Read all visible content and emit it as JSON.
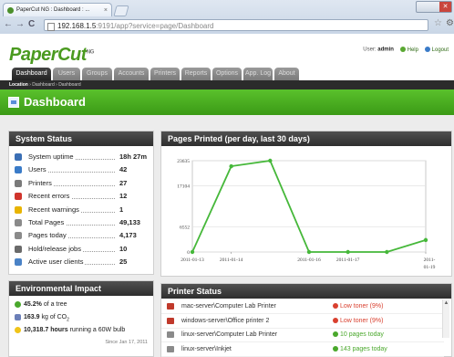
{
  "browser": {
    "tab_title": "PaperCut NG : Dashboard : ...",
    "tab_close": "×",
    "nav_back": "←",
    "nav_forward": "→",
    "nav_reload": "C",
    "url_host": "192.168.1.5",
    "url_rest": ":9191/app?service=page/Dashboard",
    "star": "☆",
    "menu": "🔧"
  },
  "header": {
    "logo": "PaperCut",
    "logo_mark": "NG",
    "user_label": "User:",
    "user_name": "admin",
    "help": "Help",
    "logout": "Logout"
  },
  "tabs": [
    {
      "label": "Dashboard",
      "active": true
    },
    {
      "label": "Users"
    },
    {
      "label": "Groups"
    },
    {
      "label": "Accounts"
    },
    {
      "label": "Printers"
    },
    {
      "label": "Reports"
    },
    {
      "label": "Options"
    },
    {
      "label": "App. Log"
    },
    {
      "label": "About"
    }
  ],
  "location": {
    "prefix": "Location",
    "path": "› Dashboard › Dashboard"
  },
  "page_title": "Dashboard",
  "system_status": {
    "title": "System Status",
    "rows": [
      {
        "label": "System uptime",
        "value": "18h 27m",
        "color": "#3b6fb5"
      },
      {
        "label": "Users",
        "value": "42",
        "color": "#3a7bc8"
      },
      {
        "label": "Printers",
        "value": "27",
        "color": "#7a7a7a"
      },
      {
        "label": "Recent errors",
        "value": "12",
        "color": "#d0342c"
      },
      {
        "label": "Recent warnings",
        "value": "1",
        "color": "#e8b400"
      },
      {
        "label": "Total Pages",
        "value": "49,133",
        "color": "#8a8a8a"
      },
      {
        "label": "Pages today",
        "value": "4,173",
        "color": "#8a8a8a"
      },
      {
        "label": "Hold/release jobs",
        "value": "10",
        "color": "#6a6a6a"
      },
      {
        "label": "Active user clients",
        "value": "25",
        "color": "#4a82c6"
      }
    ]
  },
  "environment": {
    "title": "Environmental Impact",
    "trees_value": "45.2%",
    "trees_text": "of a tree",
    "co2_value": "163.9",
    "co2_text": "kg of CO",
    "co2_sub": "2",
    "bulb_value": "10,318.7 hours",
    "bulb_text": "running a 60W bulb",
    "since": "Since Jan 17, 2011"
  },
  "chart_panel": {
    "title": "Pages Printed (per day, last 30 days)"
  },
  "chart_data": {
    "type": "line",
    "x": [
      "2011-01-13",
      "2011-01-14",
      "2011-01-15",
      "2011-01-16",
      "2011-01-17",
      "2011-01-18",
      "2011-01-19"
    ],
    "series": [
      {
        "values": [
          0,
          22200,
          23635,
          0,
          0,
          0,
          3100
        ]
      }
    ],
    "x_tick_labels": [
      "2011-01-13",
      "2011-01-14",
      "2011-01-16",
      "2011-01-17",
      "2011-01-19"
    ],
    "x_tick_indices": [
      0,
      1,
      3,
      4,
      6
    ],
    "y_ticks": [
      0,
      6552,
      17104,
      23635
    ],
    "ylim": [
      0,
      23635
    ],
    "color": "#46b83a",
    "grid": true
  },
  "printer_status": {
    "title": "Printer Status",
    "rows": [
      {
        "name": "mac-server\\Computer Lab Printer",
        "status": "Low toner (9%)",
        "level": "error"
      },
      {
        "name": "windows-server\\Office printer 2",
        "status": "Low toner (9%)",
        "level": "error"
      },
      {
        "name": "linux-server\\Computer Lab Printer",
        "status": "10 pages today",
        "level": "ok"
      },
      {
        "name": "linux-server\\Inkjet",
        "status": "143 pages today",
        "level": "ok"
      }
    ],
    "colors": {
      "error": "#d9402f",
      "ok": "#4aa82c"
    }
  }
}
